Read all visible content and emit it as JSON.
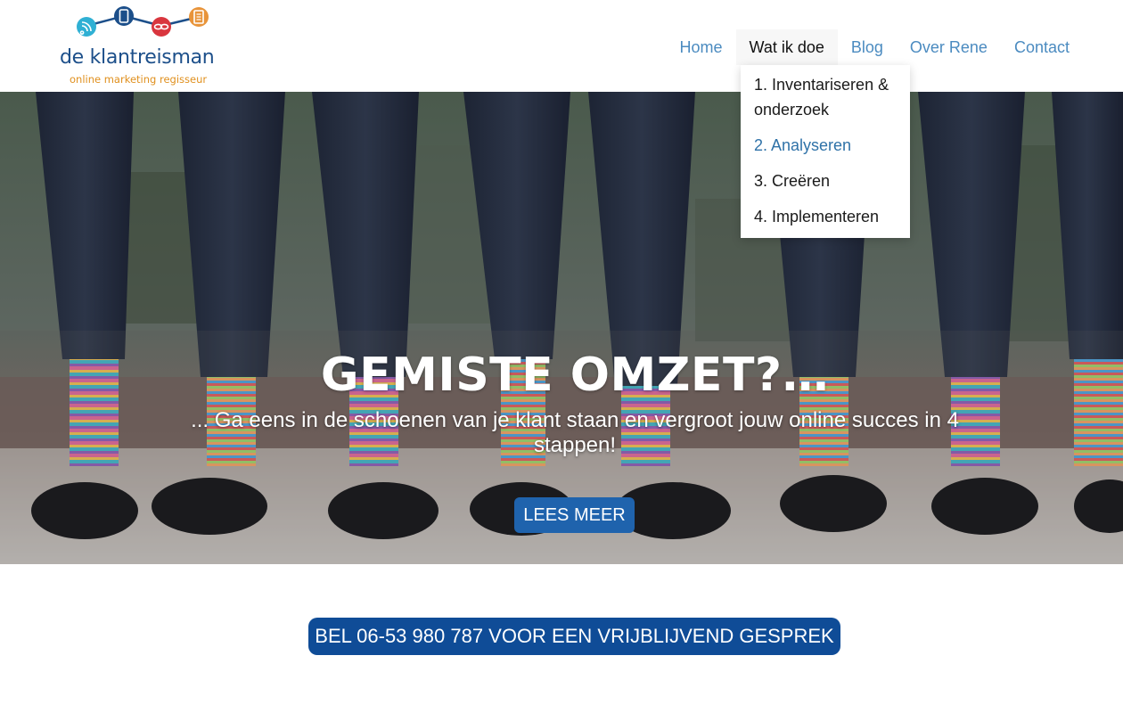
{
  "logo": {
    "name": "de klantreisman",
    "tagline": "online marketing regisseur",
    "icons": [
      "rss-icon",
      "mobile-icon",
      "link-icon",
      "document-icon"
    ],
    "colors": [
      "#2fb0d4",
      "#1c4f8a",
      "#d9363e",
      "#e8943a"
    ]
  },
  "nav": {
    "items": [
      {
        "label": "Home"
      },
      {
        "label": "Wat ik doe"
      },
      {
        "label": "Blog"
      },
      {
        "label": "Over Rene"
      },
      {
        "label": "Contact"
      }
    ],
    "active_index": 1
  },
  "dropdown": {
    "items": [
      {
        "label": "1. Inventariseren & onderzoek"
      },
      {
        "label": "2. Analyseren"
      },
      {
        "label": "3. Creëren"
      },
      {
        "label": "4. Implementeren"
      }
    ],
    "highlighted_index": 1
  },
  "hero": {
    "title": "GEMISTE OMZET?…",
    "subtitle": "... Ga eens in de schoenen van je klant staan en vergroot jouw online succes in 4 stappen!",
    "button_label": "LEES MEER"
  },
  "cta": {
    "label": "BEL 06-53 980 787 VOOR EEN VRIJBLIJVEND GESPREK"
  },
  "colors": {
    "nav_link": "#4b8bc0",
    "accent_blue": "#1f63ad",
    "cta_blue": "#0f4c97",
    "logo_orange": "#e0901e"
  }
}
